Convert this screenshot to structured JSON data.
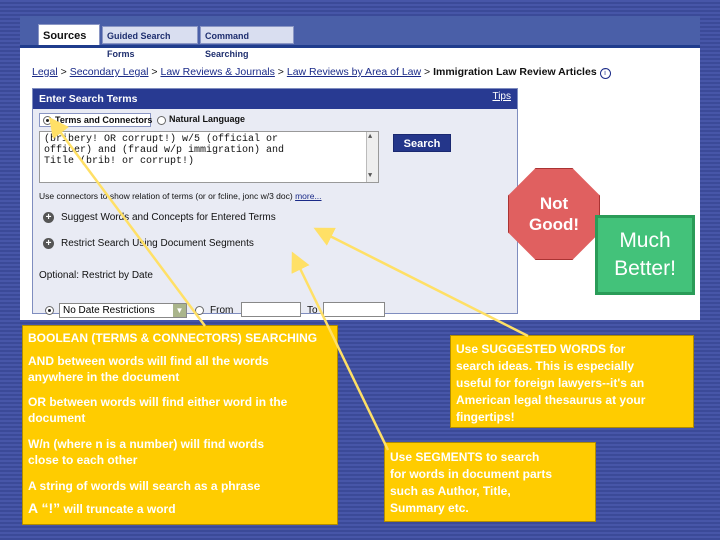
{
  "tabs": {
    "sources": "Sources",
    "guided": "Guided Search Forms",
    "command": "Command Searching"
  },
  "breadcrumb": {
    "legal": "Legal",
    "sep": ">",
    "secondary": "Secondary Legal",
    "law_reviews": "Law Reviews & Journals",
    "by_area": "Law Reviews by Area of Law",
    "current": "Immigration Law Review Articles",
    "info_icon": "info-icon"
  },
  "panel": {
    "title": "Enter Search Terms",
    "tips": "Tips",
    "terms_connectors": "Terms and Connectors",
    "natural_language": "Natural Language",
    "search_lines": [
      "(bribery! OR corrupt!) w/5 (official or",
      "officer) and (fraud w/p immigration) and",
      "Title (brib! or corrupt!)"
    ],
    "search_button": "Search",
    "connector_hint": "Use connectors to show relation of terms (or or fcline, jonc w/3 doc)",
    "more": "more...",
    "suggest": "Suggest Words and Concepts for Entered Terms",
    "restrict": "Restrict Search Using Document Segments",
    "optional_date": "Optional: Restrict by Date",
    "no_date": "No Date Restrictions",
    "from": "From",
    "to": "To"
  },
  "callouts": {
    "not_good": [
      "Not",
      "Good!"
    ],
    "much_better": [
      "Much",
      "Better!"
    ]
  },
  "boolean_box": {
    "heading": "BOOLEAN (TERMS & CONNECTORS) SEARCHING",
    "and_text": [
      "AND between words will find all the words",
      "anywhere in the document"
    ],
    "or_text": [
      "OR between words will find either word in the",
      "document"
    ],
    "wn_text": [
      "W/n (where n is a number) will find words",
      "close to each other"
    ],
    "string_text": "A string of words will search as a phrase",
    "trunc_prefix": "A “!”",
    "trunc_text": "will truncate a word"
  },
  "suggested_box": {
    "lines": [
      "Use SUGGESTED WORDS for",
      "search ideas. This is especially",
      "useful for foreign lawyers--it's an",
      "American legal thesaurus at your",
      "fingertips!"
    ]
  },
  "segments_box": {
    "lines": [
      "Use SEGMENTS to search",
      "for words in document parts",
      "such as Author, Title,",
      "Summary etc."
    ]
  },
  "colors": {
    "background": "#3f4f9e",
    "yellow": "#ffcc00",
    "red": "#e06060",
    "green": "#43c27a",
    "header_blue": "#283a92"
  }
}
